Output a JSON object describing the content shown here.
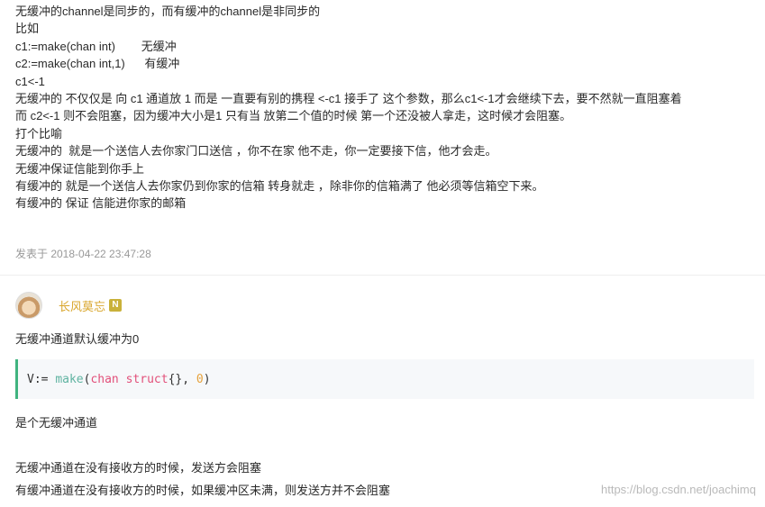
{
  "post": {
    "lines": [
      "无缓冲的channel是同步的，而有缓冲的channel是非同步的",
      "比如",
      "c1:=make(chan int)        无缓冲",
      "c2:=make(chan int,1)      有缓冲",
      "c1<-1",
      "无缓冲的 不仅仅是 向 c1 通道放 1 而是 一直要有别的携程 <-c1 接手了 这个参数，那么c1<-1才会继续下去，要不然就一直阻塞着",
      "而 c2<-1 则不会阻塞，因为缓冲大小是1 只有当 放第二个值的时候 第一个还没被人拿走，这时候才会阻塞。",
      "打个比喻",
      "无缓冲的  就是一个送信人去你家门口送信 ，你不在家 他不走，你一定要接下信，他才会走。",
      "无缓冲保证信能到你手上",
      "有缓冲的 就是一个送信人去你家仍到你家的信箱 转身就走 ，除非你的信箱满了 他必须等信箱空下来。",
      "有缓冲的 保证 信能进你家的邮箱"
    ],
    "meta": "发表于 2018-04-22 23:47:28"
  },
  "comment": {
    "author": "长风莫忘",
    "badge": "N",
    "intro": "无缓冲通道默认缓冲为0",
    "code": {
      "var": "V:= ",
      "func": "make",
      "open": "(",
      "kw1": "chan",
      "sp": " ",
      "kw2": "struct",
      "mid": "{}, ",
      "num": "0",
      "close": ")"
    },
    "after_code": "是个无缓冲通道",
    "line_a": "无缓冲通道在没有接收方的时候，发送方会阻塞",
    "line_b": "有缓冲通道在没有接收方的时候，如果缓冲区未满，则发送方并不会阻塞"
  },
  "watermark": "https://blog.csdn.net/joachimq"
}
